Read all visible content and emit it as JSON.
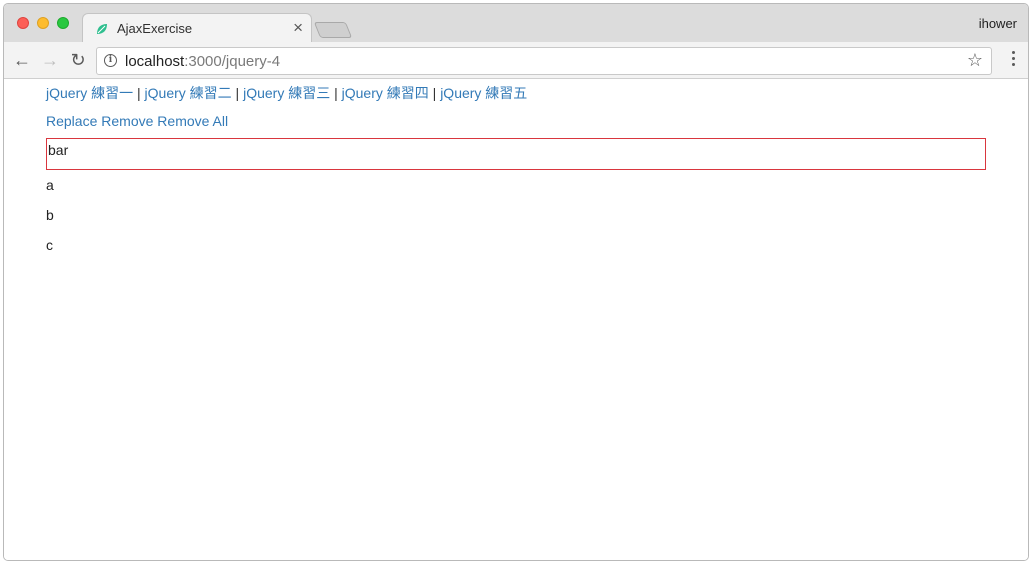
{
  "browser": {
    "tab_title": "AjaxExercise",
    "profile_name": "ihower",
    "url_host": "localhost",
    "url_path": ":3000/jquery-4"
  },
  "page": {
    "nav_links": [
      {
        "label": "jQuery 練習一"
      },
      {
        "label": "jQuery 練習二"
      },
      {
        "label": "jQuery 練習三"
      },
      {
        "label": "jQuery 練習四"
      },
      {
        "label": "jQuery 練習五"
      }
    ],
    "separator": " | ",
    "actions": [
      {
        "label": "Replace"
      },
      {
        "label": "Remove"
      },
      {
        "label": "Remove All"
      }
    ],
    "highlighted_item": "bar",
    "items": [
      "a",
      "b",
      "c"
    ]
  },
  "colors": {
    "link": "#337ab7",
    "highlight_border": "#d9363e"
  }
}
